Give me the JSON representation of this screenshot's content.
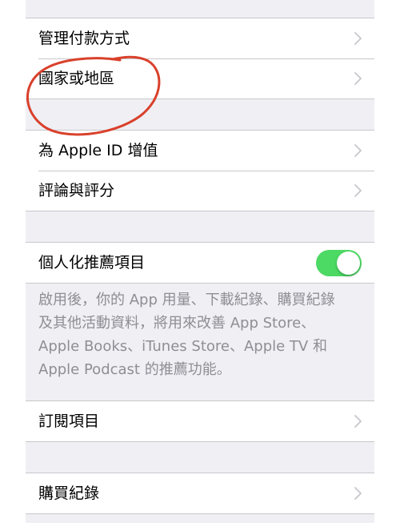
{
  "colors": {
    "background": "#efeff4",
    "cell": "#ffffff",
    "separator": "#c8c7cc",
    "toggle_on": "#4cd964",
    "footnote": "#8e8e93",
    "chevron": "#c7c7cc",
    "annotation_circle": "#d9402b"
  },
  "group1": {
    "payment": {
      "label": "管理付款方式",
      "icon": "chevron-right-icon"
    },
    "country": {
      "label": "國家或地區",
      "icon": "chevron-right-icon"
    }
  },
  "group2": {
    "add_funds": {
      "label": "為 Apple ID 增值",
      "icon": "chevron-right-icon"
    },
    "ratings": {
      "label": "評論與評分",
      "icon": "chevron-right-icon"
    }
  },
  "group3": {
    "personalized": {
      "label": "個人化推薦項目",
      "toggle_state": "on"
    },
    "footnote": {
      "line1": "啟用後，你的 App 用量、下載紀錄、購買紀錄",
      "line2": "及其他活動資料，將用來改善 App Store、",
      "line3": "Apple Books、iTunes Store、Apple TV 和",
      "line4": "Apple Podcast 的推薦功能。"
    }
  },
  "group4": {
    "subscriptions": {
      "label": "訂閱項目",
      "icon": "chevron-right-icon"
    }
  },
  "group5": {
    "purchase_history": {
      "label": "購買紀錄",
      "icon": "chevron-right-icon"
    }
  }
}
